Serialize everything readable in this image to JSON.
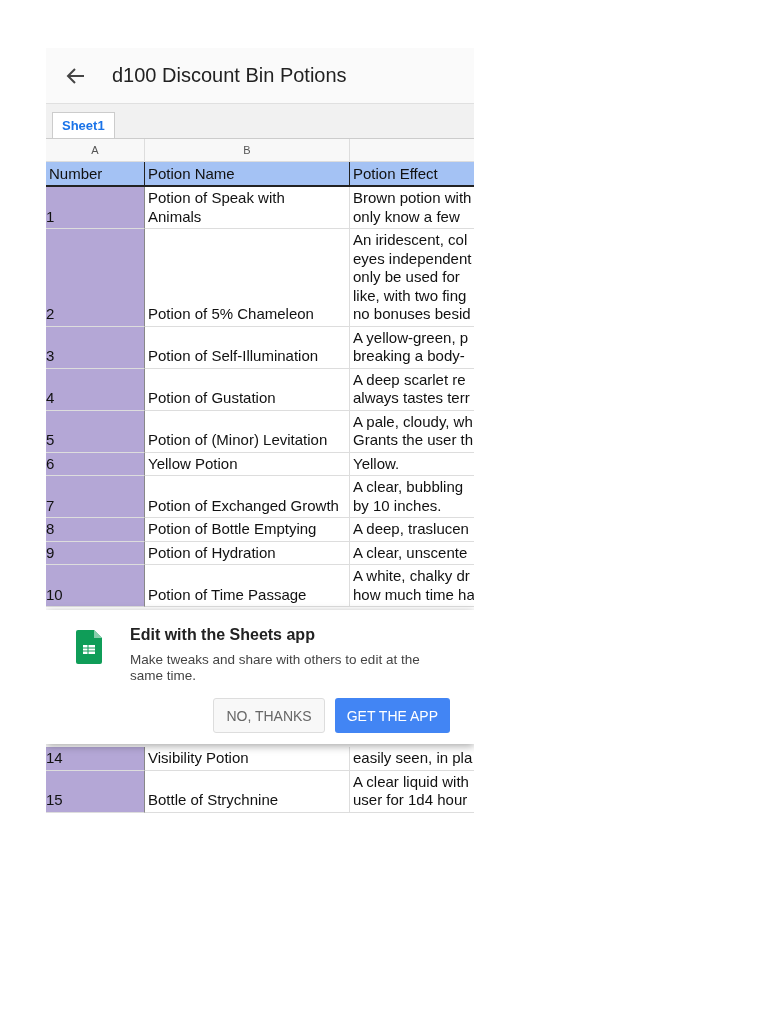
{
  "header": {
    "title": "d100 Discount Bin Potions"
  },
  "tabs": [
    {
      "label": "Sheet1",
      "selected": true
    }
  ],
  "table": {
    "column_letters": [
      "A",
      "B"
    ],
    "columns": [
      "Number",
      "Potion Name",
      "Potion Effect"
    ],
    "rows": [
      {
        "cells": [
          "1",
          "Potion of Speak with\nAnimals",
          "Brown potion with\nonly know a few"
        ]
      },
      {
        "cells": [
          "2",
          "Potion of 5% Chameleon",
          "An iridescent, col\neyes independent\nonly be used for\nlike, with two fing\nno bonuses besid"
        ]
      },
      {
        "cells": [
          "3",
          "Potion of Self-Illumination",
          "A yellow-green, p\nbreaking a body-"
        ]
      },
      {
        "cells": [
          "4",
          "Potion of Gustation",
          "A deep scarlet re\nalways tastes terr"
        ]
      },
      {
        "cells": [
          "5",
          "Potion of (Minor) Levitation",
          "A pale, cloudy, wh\nGrants the user th"
        ]
      },
      {
        "cells": [
          "6",
          "Yellow Potion",
          "Yellow."
        ]
      },
      {
        "cells": [
          "7",
          "Potion of Exchanged Growth",
          "A clear, bubbling\nby 10 inches."
        ]
      },
      {
        "cells": [
          "8",
          "Potion of Bottle Emptying",
          "A deep, traslucen"
        ]
      },
      {
        "cells": [
          "9",
          "Potion of Hydration",
          "A clear, unscente"
        ]
      },
      {
        "cells": [
          "10",
          "Potion of Time Passage",
          "A white, chalky dr\nhow much time ha"
        ]
      }
    ],
    "rows_after_dialog": [
      {
        "cells": [
          "14",
          "Visibility Potion",
          "easily seen, in pla"
        ]
      },
      {
        "cells": [
          "15",
          "Bottle of Strychnine",
          "A clear liquid with\nuser for 1d4 hour"
        ]
      }
    ]
  },
  "dialog": {
    "title": "Edit with the Sheets app",
    "message": "Make tweaks and share with others to edit at the same time.",
    "buttons": [
      {
        "label": "NO, THANKS",
        "kind": "secondary"
      },
      {
        "label": "GET THE APP",
        "kind": "primary"
      }
    ]
  }
}
